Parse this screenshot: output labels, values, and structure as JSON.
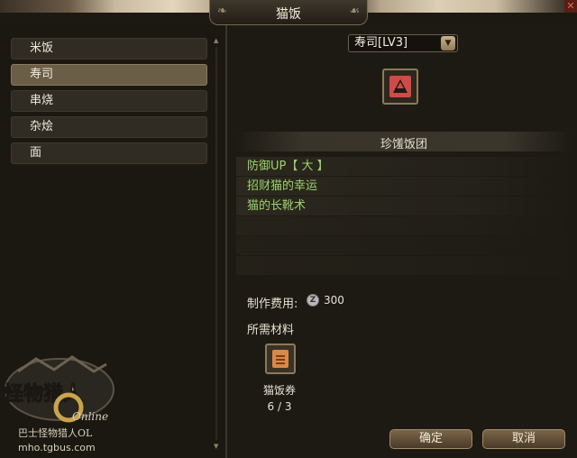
{
  "window": {
    "title": "猫饭",
    "close_icon": "close-icon"
  },
  "categories": [
    {
      "label": "米饭",
      "selected": false
    },
    {
      "label": "寿司",
      "selected": true
    },
    {
      "label": "串烧",
      "selected": false
    },
    {
      "label": "杂烩",
      "selected": false
    },
    {
      "label": "面",
      "selected": false
    }
  ],
  "recipe": {
    "dropdown_value": "寿司[LV3]",
    "dish_name": "珍馐饭团",
    "skills": [
      "防御UP【 大 】",
      "招财猫的幸运",
      "猫的长靴术"
    ]
  },
  "cost": {
    "label": "制作费用:",
    "value": "300",
    "currency_icon": "zenny-icon"
  },
  "materials": {
    "label": "所需材料",
    "items": [
      {
        "name": "猫饭券",
        "count": "6 / 3",
        "icon": "ticket-icon"
      }
    ]
  },
  "buttons": {
    "confirm": "确定",
    "cancel": "取消"
  },
  "watermark": {
    "logo_text": "怪物猎人",
    "logo_sub": "Online",
    "line1": "巴士怪物猎人OL",
    "line2": "mho.tgbus.com"
  },
  "colors": {
    "skill_text": "#9bd36a",
    "selected_item": "#6b5e47"
  }
}
